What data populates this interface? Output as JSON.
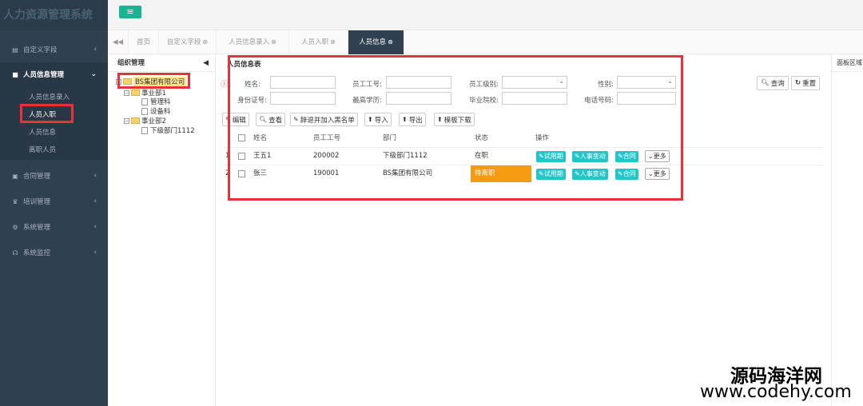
{
  "app": {
    "title": "人力资源管理系统",
    "menu_icon": "≡"
  },
  "sidebar": {
    "items": [
      {
        "label": "自定义字段",
        "icon": "field-icon"
      },
      {
        "label": "人员信息管理",
        "icon": "users-icon"
      },
      {
        "label": "合同管理",
        "icon": "contract-icon"
      },
      {
        "label": "培训管理",
        "icon": "trophy-icon"
      },
      {
        "label": "系统管理",
        "icon": "gears-icon"
      },
      {
        "label": "系统监控",
        "icon": "headset-icon"
      }
    ],
    "subitems": [
      "人员信息录入",
      "人员入职",
      "人员信息",
      "离职人员"
    ]
  },
  "tabs": [
    {
      "label": "首页"
    },
    {
      "label": "自定义字段"
    },
    {
      "label": "人员信息录入"
    },
    {
      "label": "人员入职"
    },
    {
      "label": "人员信息"
    }
  ],
  "org": {
    "title": "组织管理",
    "root": "BS集团有限公司",
    "nodes": [
      "事业部1",
      "管理科",
      "设备科",
      "事业部2",
      "下级部门1112"
    ]
  },
  "form": {
    "title": "人员信息表",
    "labels": {
      "name": "姓名:",
      "emp_no": "员工工号:",
      "level": "员工级别:",
      "gender": "性别:",
      "id_card": "身份证号:",
      "degree": "最高学历:",
      "school": "毕业院校:",
      "phone": "电话号码:"
    },
    "query_label": "查询",
    "reset_label": "重置"
  },
  "toolbar": {
    "edit": "编辑",
    "view": "查看",
    "blacklist": "辞退并加入黑名单",
    "import": "导入",
    "export": "导出",
    "template": "模板下载"
  },
  "table": {
    "headers": {
      "name": "姓名",
      "emp_no": "员工工号",
      "dept": "部门",
      "status": "状态",
      "ops": "操作"
    },
    "rows": [
      {
        "num": "1",
        "name": "王五1",
        "emp_no": "200002",
        "dept": "下级部门1112",
        "status": "在职"
      },
      {
        "num": "2",
        "name": "张三",
        "emp_no": "190001",
        "dept": "BS集团有限公司",
        "status": "待离职"
      }
    ],
    "actions": {
      "trial": "试用期",
      "transfer": "人事变动",
      "contract": "合同",
      "more": "更多"
    }
  },
  "right_panel": {
    "title": "面板区域"
  },
  "watermark": {
    "line1": "源码海洋网",
    "line2": "www.codehy.com"
  },
  "colors": {
    "sidebar": "#2f4050",
    "accent": "#1ab394",
    "action": "#23c6c8",
    "pending": "#f59a11",
    "highlight": "#e8323b"
  }
}
